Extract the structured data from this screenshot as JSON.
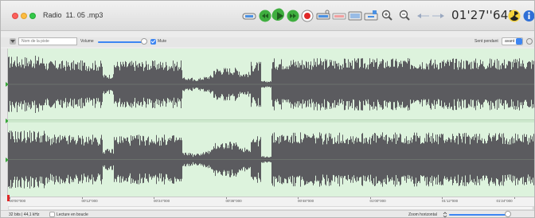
{
  "window": {
    "title": "Radio  11. 05 .mp3"
  },
  "toolbar": {
    "time_display": "01'27''645",
    "icons": [
      "selection-tool-icon",
      "rewind-icon",
      "play-icon",
      "forward-icon",
      "record-icon",
      "cut-icon",
      "copy-icon",
      "paste-icon",
      "insert-icon",
      "zoom-in-icon",
      "zoom-out-icon",
      "move-left-icon",
      "move-right-icon",
      "radioactive-icon",
      "info-icon"
    ]
  },
  "controls": {
    "name_placeholder": "Nom de la piste",
    "volume_label": "Volume",
    "volume_level": 0.92,
    "mute_label": "Mute",
    "mute_checked": true,
    "fade_label": "Sent pendant",
    "fade_value": "avant"
  },
  "ruler": {
    "ticks": [
      "00'00''000",
      "00'12''000",
      "00'24''000",
      "00'36''000",
      "00'48''000",
      "01'00''000",
      "01'12''000",
      "01'24''000"
    ]
  },
  "status": {
    "format": "32 bits | 44,1 kHz",
    "loop_label": "Lecture en boucle",
    "loop_checked": false,
    "zoom_label": "Zoom horizontal",
    "zoom_level": 0.95
  },
  "colors": {
    "waveform": "#5b5b5f",
    "track_bg": "#ddf3dd",
    "accent": "#3d86f2",
    "play_green": "#3fae3f",
    "record_red": "#e02828"
  }
}
